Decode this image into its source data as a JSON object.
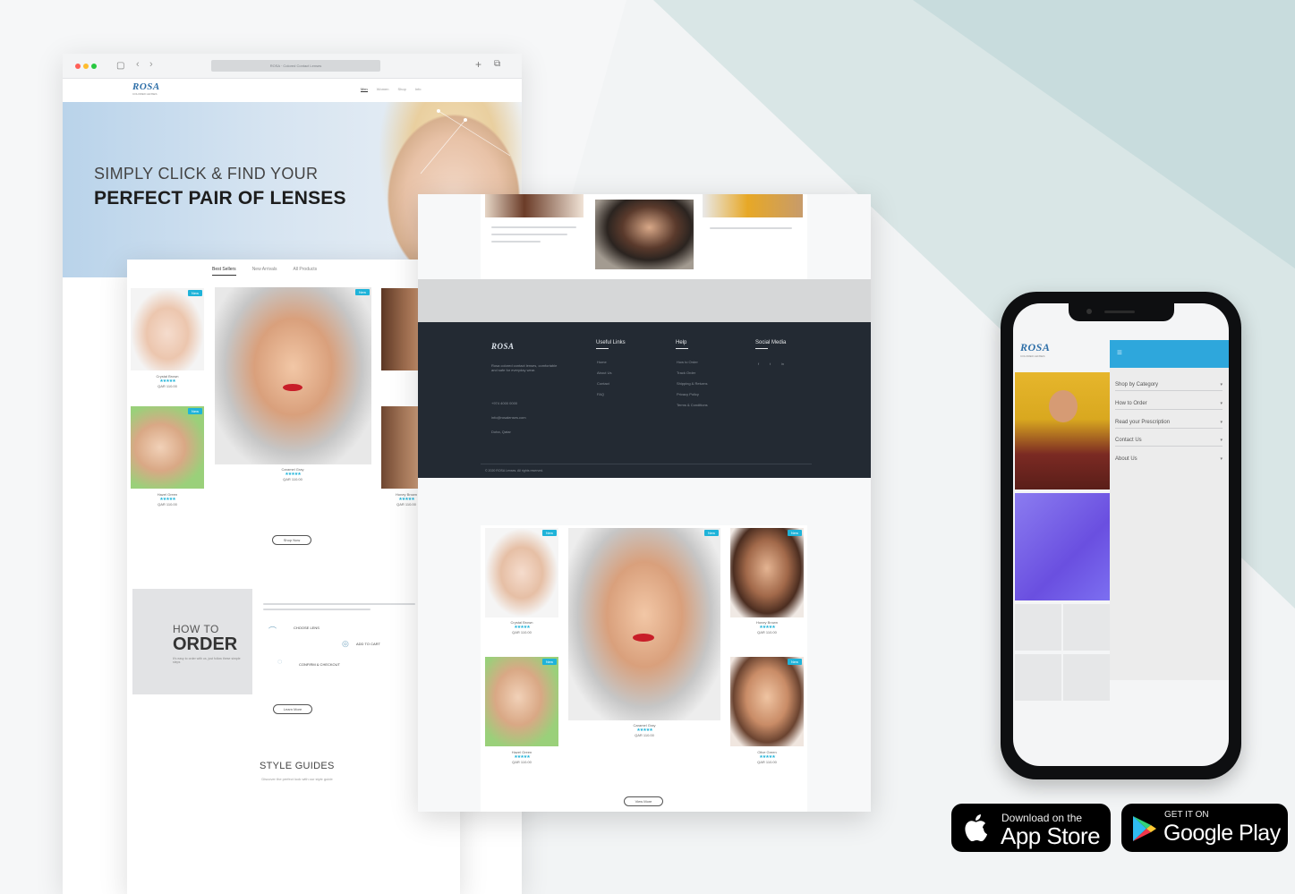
{
  "browser": {
    "url": "ROSA · Colored Contact Lenses",
    "nav": [
      "Men",
      "Women",
      "Shop",
      "Info"
    ]
  },
  "brand": {
    "name": "ROSA",
    "tagline": "COLORED LENSES"
  },
  "hero": {
    "line1": "SIMPLY CLICK & FIND YOUR",
    "line2": "PERFECT PAIR OF LENSES"
  },
  "product_tabs": [
    "Best Sellers",
    "New Arrivals",
    "All Products"
  ],
  "products": [
    {
      "name": "Crystal Brown",
      "price": "QAR 110.00",
      "badge": "New"
    },
    {
      "name": "Hazel Green",
      "price": "QAR 110.00",
      "badge": "New"
    },
    {
      "name": "Caramel Gray",
      "price": "QAR 110.00",
      "badge": "New"
    },
    {
      "name": "Honey Brown",
      "price": "QAR 110.00",
      "badge": "New"
    },
    {
      "name": "Olive Green",
      "price": "QAR 110.00",
      "badge": "New"
    }
  ],
  "stars": "★★★★★",
  "buttons": {
    "shop_now": "Shop Now",
    "learn_more": "Learn More",
    "view_more": "View More"
  },
  "how_to_order": {
    "line1": "HOW TO",
    "line2": "ORDER",
    "text": "It's easy to order with us, just follow these simple steps",
    "steps": [
      "CHOOSE LENS",
      "ADD TO CART",
      "CONFIRM & CHECKOUT"
    ]
  },
  "style_guides": {
    "title": "STYLE GUIDES",
    "subtitle": "Discover the perfect look with our style guide"
  },
  "footer": {
    "columns": [
      {
        "title": "Useful Links",
        "links": [
          "Home",
          "About Us",
          "Contact",
          "FAQ"
        ]
      },
      {
        "title": "Help",
        "links": [
          "How to Order",
          "Track Order",
          "Shipping & Returns",
          "Privacy Policy",
          "Terms & Conditions"
        ]
      },
      {
        "title": "Social Media",
        "links": [
          "f",
          "t",
          "in"
        ]
      }
    ],
    "about": "Rosa colored contact lenses, comfortable and safe for everyday wear.",
    "contacts": [
      "+974 4000 0000",
      "info@rosalenses.com",
      "Doha, Qatar"
    ],
    "copyright": "© 2020 ROSA Lenses. All rights reserved."
  },
  "phone_menu": {
    "items": [
      "Shop by Category",
      "How to Order",
      "Read your Prescription",
      "Contact Us",
      "About Us"
    ]
  },
  "app_store": {
    "small": "Download on the",
    "big": "App Store"
  },
  "google_play": {
    "small": "GET IT ON",
    "big": "Google Play"
  },
  "colors": {
    "accent": "#1fb3d9",
    "footer": "#232a33",
    "menu_header": "#2ea7dc"
  }
}
